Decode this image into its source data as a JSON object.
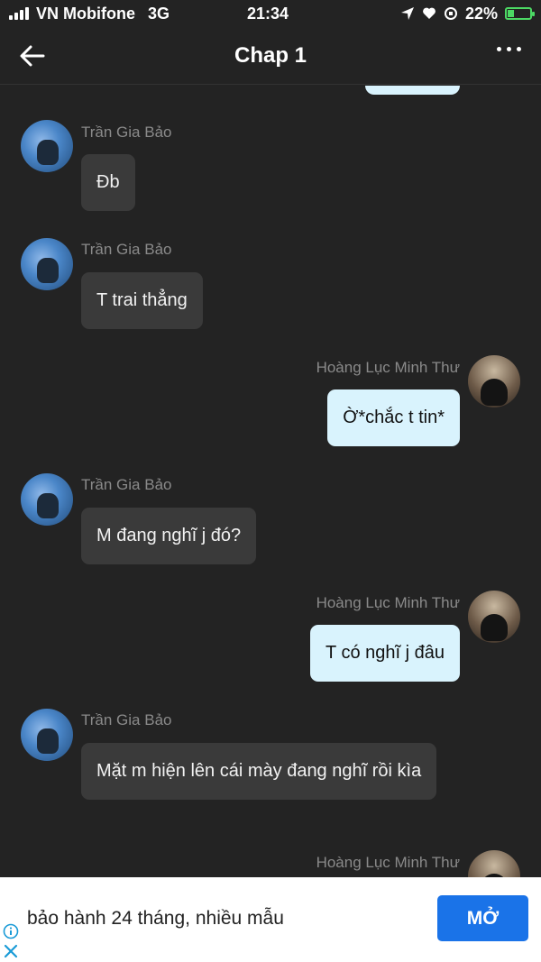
{
  "status_bar": {
    "carrier": "VN Mobifone",
    "network": "3G",
    "time": "21:34",
    "battery": "22%",
    "battery_level": 0.22
  },
  "header": {
    "title": "Chap 1",
    "back_icon": "back-arrow-icon",
    "more_icon": "more-dots-icon"
  },
  "messages": [
    {
      "sender": "Trần Gia Bảo",
      "text": "Đb",
      "direction": "in"
    },
    {
      "sender": "Trần Gia Bảo",
      "text": "T trai thẳng",
      "direction": "in"
    },
    {
      "sender": "Hoàng Lục Minh Thư",
      "text": "Ờ*chắc t tin*",
      "direction": "out"
    },
    {
      "sender": "Trần Gia Bảo",
      "text": "M đang nghĩ j đó?",
      "direction": "in"
    },
    {
      "sender": "Hoàng Lục Minh Thư",
      "text": "T có nghĩ j đâu",
      "direction": "out"
    },
    {
      "sender": "Trần Gia Bảo",
      "text": "Mặt m hiện lên cái mày đang nghĩ rồi kìa",
      "direction": "in"
    },
    {
      "sender": "Hoàng Lục Minh Thư",
      "text": "",
      "direction": "out"
    }
  ],
  "ad": {
    "text": "bảo hành 24 tháng, nhiều mẫu",
    "button_label": "MỞ",
    "colors": {
      "button": "#1a73e8"
    }
  },
  "colors": {
    "background": "#232323",
    "incoming_bubble": "#3a3a3a",
    "outgoing_bubble": "#d9f3fd",
    "sender_name": "#8a8a8a"
  }
}
